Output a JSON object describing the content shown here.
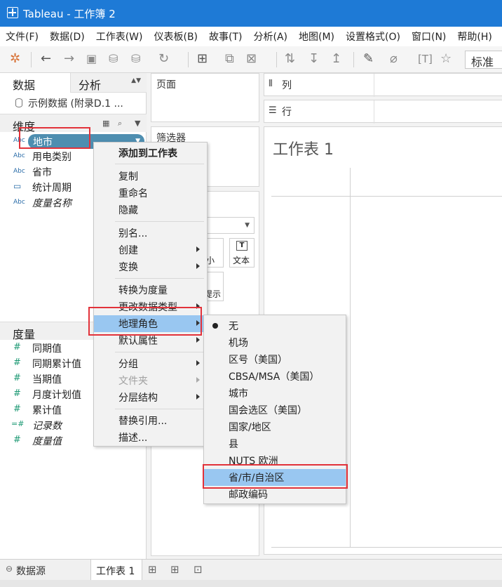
{
  "window": {
    "title": "Tableau - 工作簿 2"
  },
  "menubar": [
    "文件(F)",
    "数据(D)",
    "工作表(W)",
    "仪表板(B)",
    "故事(T)",
    "分析(A)",
    "地图(M)",
    "设置格式(O)",
    "窗口(N)",
    "帮助(H)"
  ],
  "toolbar": {
    "fit_select": "标准"
  },
  "left_pane": {
    "tab_data": "数据",
    "tab_analysis": "分析",
    "datasource": "示例数据 (附录D.1 ...",
    "dimensions_label": "维度",
    "dimensions": [
      {
        "type": "Abc",
        "name": "地市"
      },
      {
        "type": "Abc",
        "name": "用电类别"
      },
      {
        "type": "Abc",
        "name": "省市"
      },
      {
        "type": "date",
        "name": "统计周期"
      },
      {
        "type": "Abc",
        "name": "度量名称"
      }
    ],
    "measures_label": "度量",
    "measures": [
      {
        "type": "#",
        "name": "同期值"
      },
      {
        "type": "#",
        "name": "同期累计值"
      },
      {
        "type": "#",
        "name": "当期值"
      },
      {
        "type": "#",
        "name": "月度计划值"
      },
      {
        "type": "#",
        "name": "累计值"
      },
      {
        "type": "=#",
        "name": "记录数"
      },
      {
        "type": "#",
        "name": "度量值"
      }
    ]
  },
  "cards": {
    "pages": "页面",
    "filters": "筛选器",
    "marks_size_partial": "小",
    "marks_text": "文本",
    "marks_tooltip_partial": "提示"
  },
  "shelves": {
    "columns": "列",
    "rows": "行"
  },
  "view": {
    "sheet_title": "工作表 1"
  },
  "context_menu": {
    "items": [
      {
        "label": "添加到工作表",
        "bold": true
      },
      {
        "sep": true
      },
      {
        "label": "复制"
      },
      {
        "label": "重命名"
      },
      {
        "label": "隐藏"
      },
      {
        "sep": true
      },
      {
        "label": "别名..."
      },
      {
        "label": "创建",
        "submenu": true
      },
      {
        "label": "变换",
        "submenu": true
      },
      {
        "sep": true
      },
      {
        "label": "转换为度量"
      },
      {
        "label": "更改数据类型",
        "submenu": true
      },
      {
        "label": "地理角色",
        "submenu": true,
        "highlighted": true
      },
      {
        "label": "默认属性",
        "submenu": true
      },
      {
        "sep": true
      },
      {
        "label": "分组",
        "submenu": true
      },
      {
        "label": "文件夹",
        "submenu": true,
        "disabled": true
      },
      {
        "label": "分层结构",
        "submenu": true
      },
      {
        "sep": true
      },
      {
        "label": "替换引用..."
      },
      {
        "label": "描述..."
      }
    ]
  },
  "geo_submenu": {
    "items": [
      {
        "label": "无",
        "checked": true
      },
      {
        "label": "机场"
      },
      {
        "label": "区号（美国）"
      },
      {
        "label": "CBSA/MSA（美国）"
      },
      {
        "label": "城市"
      },
      {
        "label": "国会选区（美国）"
      },
      {
        "label": "国家/地区"
      },
      {
        "label": "县"
      },
      {
        "label": "NUTS 欧洲"
      },
      {
        "label": "省/市/自治区",
        "highlighted": true
      },
      {
        "label": "邮政编码"
      }
    ]
  },
  "statusbar": {
    "datasource_tab": "数据源",
    "sheet_tab": "工作表 1"
  }
}
